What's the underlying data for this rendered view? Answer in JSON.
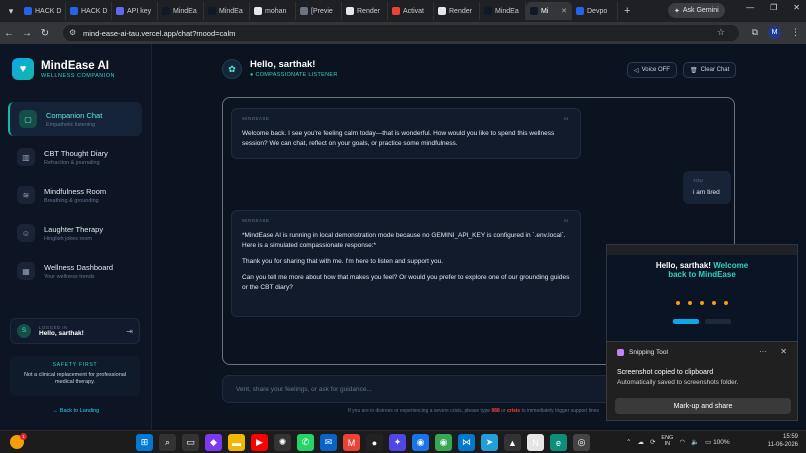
{
  "browser": {
    "tabs": [
      {
        "label": "HACK D",
        "color": "#2563eb"
      },
      {
        "label": "HACK D",
        "color": "#2563eb"
      },
      {
        "label": "API key",
        "color": "#6366f1"
      },
      {
        "label": "MindEa",
        "color": "#111827"
      },
      {
        "label": "MindEa",
        "color": "#111827"
      },
      {
        "label": "mohan",
        "color": "#e5e7eb"
      },
      {
        "label": "[Previe",
        "color": "#6b7280"
      },
      {
        "label": "Render",
        "color": "#e5e7eb"
      },
      {
        "label": "Activat",
        "color": "#ea4335"
      },
      {
        "label": "Render",
        "color": "#e5e7eb"
      },
      {
        "label": "MindEa",
        "color": "#111827"
      },
      {
        "label": "Mi",
        "color": "#111827",
        "active": true
      },
      {
        "label": "Devpo",
        "color": "#2563eb"
      }
    ],
    "ask_gemini": "Ask Gemini",
    "url": "mind-ease-ai-tau.vercel.app/chat?mood=calm",
    "profile_initial": "M"
  },
  "sidebar": {
    "brand_title": "MindEase AI",
    "brand_subtitle": "WELLNESS COMPANION",
    "items": [
      {
        "label": "Companion Chat",
        "desc": "Empathetic listening",
        "icon": "chat-icon"
      },
      {
        "label": "CBT Thought Diary",
        "desc": "Refraction & journaling",
        "icon": "book-icon"
      },
      {
        "label": "Mindfulness Room",
        "desc": "Breathing & grounding",
        "icon": "wind-icon"
      },
      {
        "label": "Laughter Therapy",
        "desc": "Hinglish jokes room",
        "icon": "smile-icon"
      },
      {
        "label": "Wellness Dashboard",
        "desc": "Your wellness trends",
        "icon": "grid-icon"
      }
    ],
    "user": {
      "caption": "LOGGED IN",
      "name": "Hello, sarthak!",
      "initial": "S"
    },
    "safety_title": "SAFETY FIRST",
    "safety_text": "Not a clinical replacement for professional medical therapy.",
    "back_link": "← Back to Landing"
  },
  "header": {
    "title": "Hello, sarthak!",
    "subtitle": "● COMPASSIONATE LISTENER",
    "voice_btn": "Voice OFF",
    "clear_btn": "Clear Chat"
  },
  "messages": [
    {
      "sender": "MINDEASE",
      "tag": "AI",
      "paragraphs": [
        "Welcome back. I see you're feeling calm today—that is wonderful. How would you like to spend this wellness session? We can chat, reflect on your goals, or practice some mindfulness."
      ]
    },
    {
      "sender": "YOU",
      "paragraphs": [
        "i am tired"
      ]
    },
    {
      "sender": "MINDEASE",
      "tag": "AI",
      "paragraphs": [
        "*MindEase AI is running in local demonstration mode because no GEMINI_API_KEY is configured in `.env.local`. Here is a simulated compassionate response:*",
        "Thank you for sharing that with me. I'm here to listen and support you.",
        "Can you tell me more about how that makes you feel? Or would you prefer to explore one of our grounding guides or the CBT diary?"
      ]
    }
  ],
  "composer": {
    "placeholder": "Vent, share your feelings, or ask for guidance..."
  },
  "crisis": {
    "before": "If you are in distress or experiencing a severe crisis, please type ",
    "code": "988",
    "mid": " or ",
    "word": "crisis",
    "after": " to immediately trigger support lines"
  },
  "preview": {
    "title_line1": "Hello, sarthak! ",
    "title_accent": "Welcome",
    "title_line2": "back to MindEase"
  },
  "toast": {
    "app": "Snipping Tool",
    "title": "Screenshot copied to clipboard",
    "body": "Automatically saved to screenshots folder.",
    "action": "Mark-up and share"
  },
  "taskbar": {
    "weather_badge": "1",
    "lang_top": "ENG",
    "lang_bottom": "IN",
    "battery": "100%",
    "time": "15:59",
    "date": "11-06-2026"
  }
}
